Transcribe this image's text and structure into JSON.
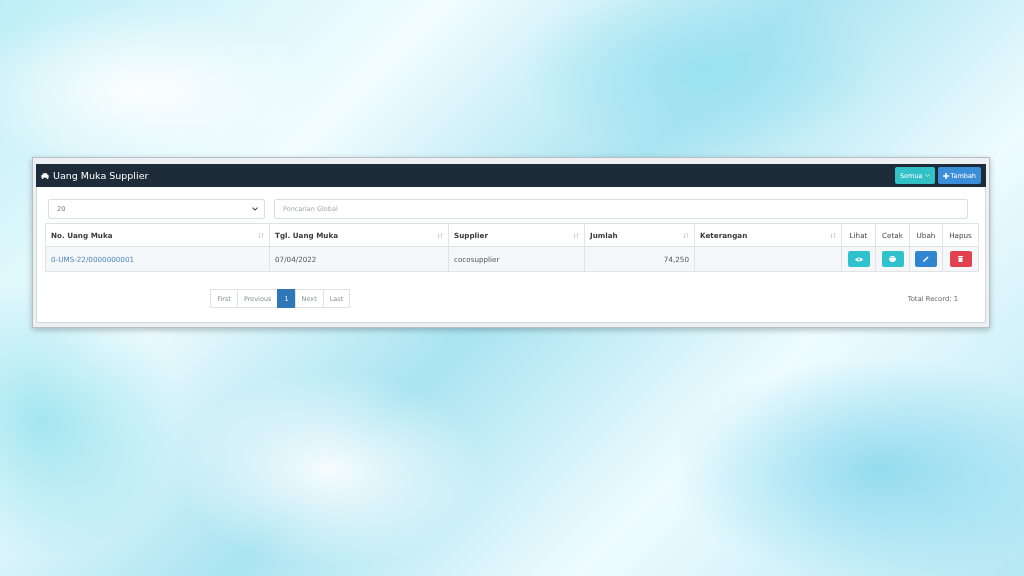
{
  "panel": {
    "title": "Uang Muka Supplier",
    "buttons": [
      {
        "label": "Semua",
        "kind": "dropdown"
      },
      {
        "label": "Tambah",
        "kind": "add"
      }
    ]
  },
  "page_size": {
    "value": "20"
  },
  "search": {
    "placeholder": "Pencarian Global"
  },
  "table": {
    "columns": [
      {
        "label": "No. Uang Muka",
        "sortable": true
      },
      {
        "label": "Tgl. Uang Muka",
        "sortable": true
      },
      {
        "label": "Supplier",
        "sortable": true
      },
      {
        "label": "Jumlah",
        "sortable": true
      },
      {
        "label": "Keterangan",
        "sortable": true
      },
      {
        "label": "Lihat",
        "sortable": false
      },
      {
        "label": "Cetak",
        "sortable": false
      },
      {
        "label": "Ubah",
        "sortable": false
      },
      {
        "label": "Hapus",
        "sortable": false
      }
    ],
    "rows": [
      {
        "number": "0-UMS-22/0000000001",
        "date": "07/04/2022",
        "supplier": "cocosupplier",
        "amount": "74,250",
        "actions": [
          {
            "kind": "view"
          },
          {
            "kind": "print"
          },
          {
            "kind": "edit"
          },
          {
            "kind": "delete"
          }
        ]
      }
    ]
  },
  "pagination": {
    "pages": [
      {
        "label": "First",
        "selected": false
      },
      {
        "label": "Previous",
        "selected": false
      },
      {
        "label": "1",
        "selected": true
      },
      {
        "label": "Next",
        "selected": false
      },
      {
        "label": "Last",
        "selected": false
      }
    ]
  },
  "total_record": "Total Record: 1"
}
